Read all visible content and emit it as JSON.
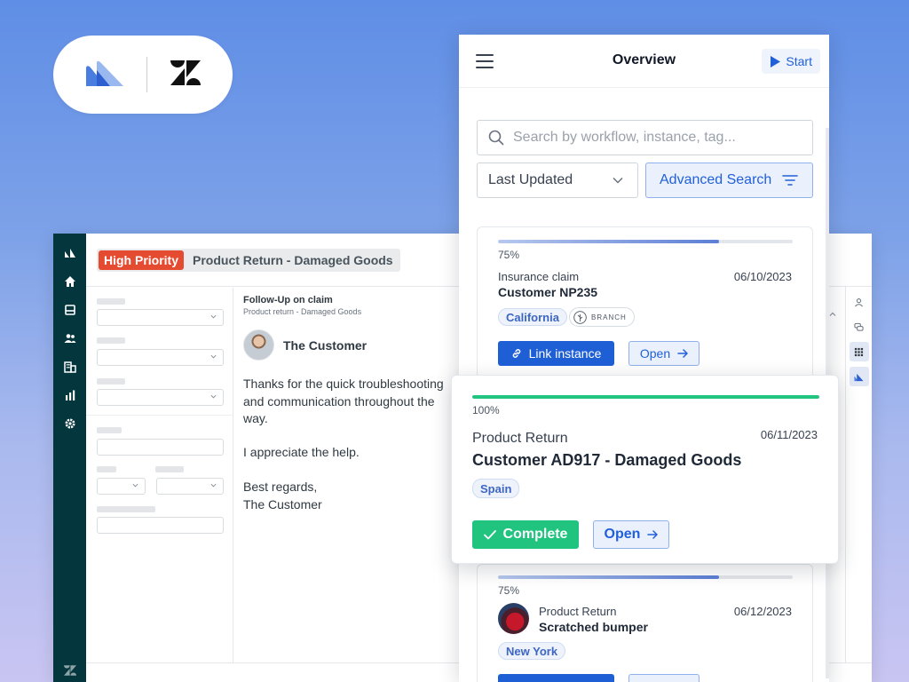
{
  "colors": {
    "brand_blue": "#1f5fd6",
    "zendesk_green": "#03363d",
    "priority_red": "#e54b30",
    "complete_green": "#21c47f",
    "progress_blue": "#6d89d8"
  },
  "logos": {
    "left": "app-logo-icon",
    "right": "zendesk-logo-icon"
  },
  "zendesk": {
    "ticket": {
      "priority": "High Priority",
      "title": "Product Return - Damaged Goods"
    },
    "conversation": {
      "subject": "Follow-Up on claim",
      "subtitle": "Product return - Damaged Goods",
      "author": "The Customer",
      "paragraph1": "Thanks for the quick troubleshooting\nand communication throughout the\nway.",
      "paragraph2": "I appreciate the help.",
      "paragraph3": "Best regards,\nThe Customer"
    }
  },
  "overview": {
    "title": "Overview",
    "start_label": "Start",
    "search_placeholder": "Search by workflow, instance, tag...",
    "sort_value": "Last Updated",
    "advanced_search_label": "Advanced Search"
  },
  "cards": [
    {
      "progress_label": "75%",
      "progress": 0.75,
      "type": "Insurance claim",
      "name": "Customer NP235",
      "date": "06/10/2023",
      "tag": "California",
      "branch_label": "BRANCH",
      "primary_label": "Link instance",
      "open_label": "Open"
    },
    {
      "progress_label": "100%",
      "progress": 1.0,
      "type": "Product Return",
      "name": "Customer AD917 - Damaged Goods",
      "date": "06/11/2023",
      "tag": "Spain",
      "complete_label": "Complete",
      "open_label": "Open"
    },
    {
      "progress_label": "75%",
      "progress": 0.75,
      "type": "Product Return",
      "name": "Scratched bumper",
      "date": "06/12/2023",
      "tag": "New York"
    }
  ]
}
